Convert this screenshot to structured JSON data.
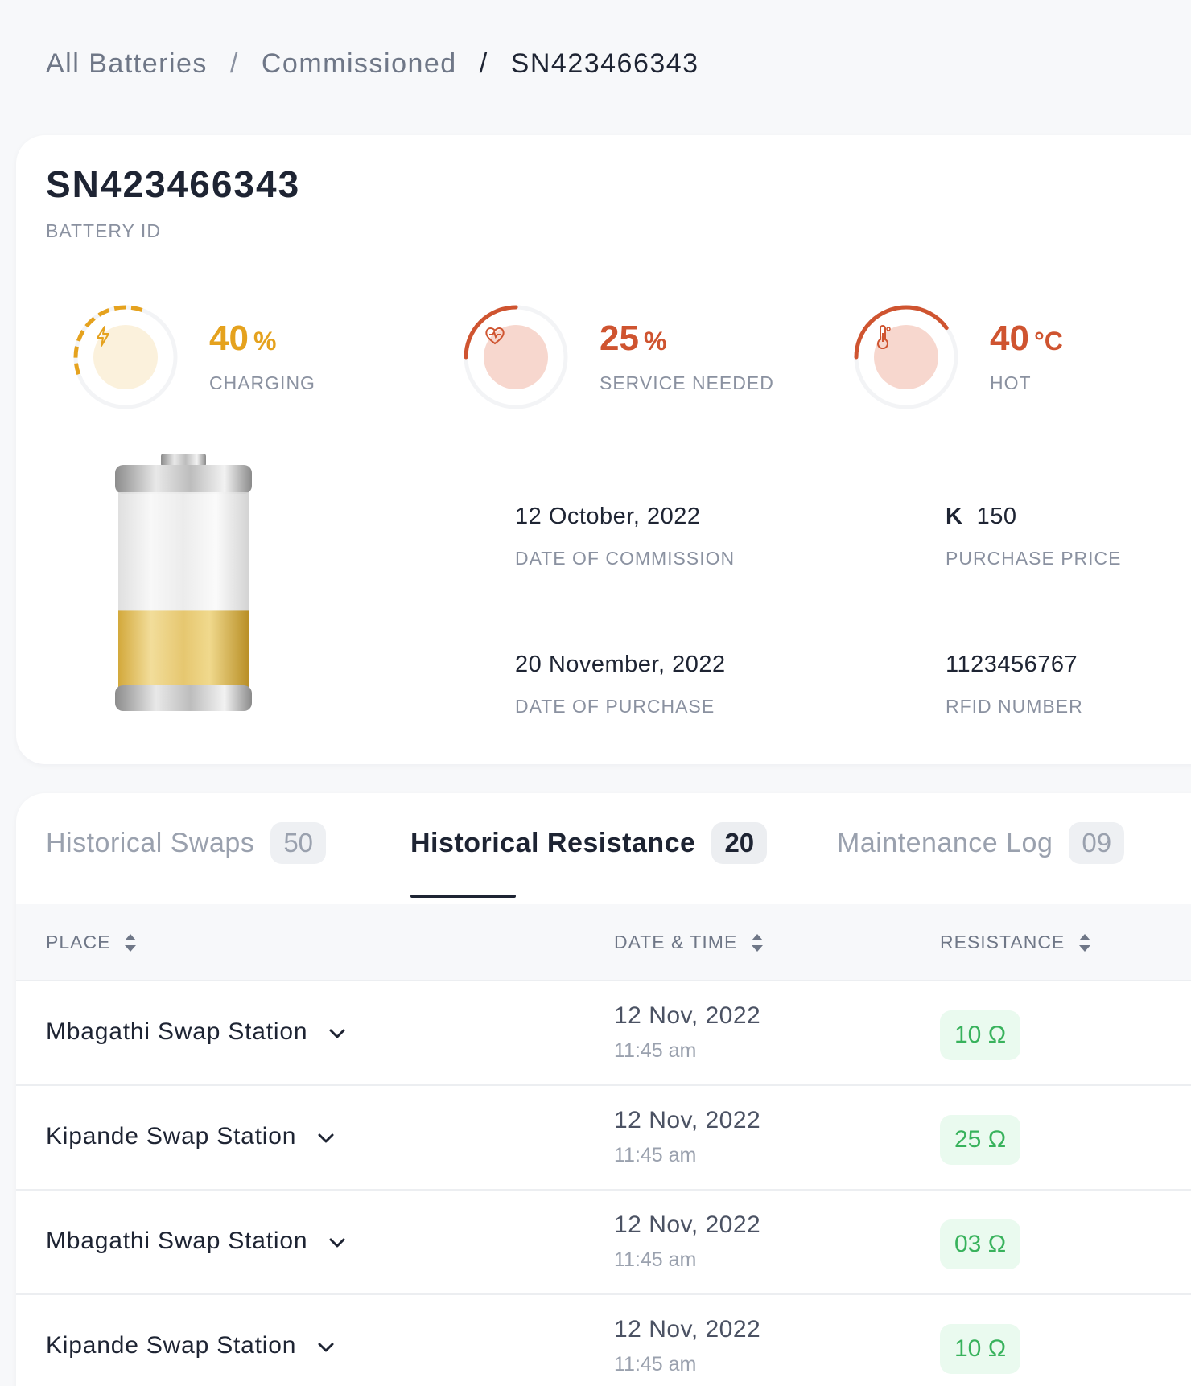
{
  "breadcrumb": {
    "items": [
      "All Batteries",
      "Commissioned",
      "SN423466343"
    ],
    "separator": "/"
  },
  "battery": {
    "id": "SN423466343",
    "id_label": "BATTERY ID",
    "stats": [
      {
        "value": "40",
        "unit": "%",
        "label": "CHARGING",
        "icon": "lightning-icon",
        "color": "#e5a21e",
        "level": 0.4
      },
      {
        "value": "25",
        "unit": "%",
        "label": "SERVICE NEEDED",
        "icon": "heart-pulse-icon",
        "color": "#cf5430",
        "level": 0.25
      },
      {
        "value": "40",
        "unit": "°C",
        "label": "HOT",
        "icon": "thermometer-icon",
        "color": "#cf5430",
        "level": 0.4
      }
    ],
    "charge_level": 0.4,
    "meta": {
      "commission_date": {
        "value": "12 October, 2022",
        "label": "DATE OF COMMISSION"
      },
      "purchase_price": {
        "currency": "K",
        "value": "150",
        "label": "PURCHASE PRICE"
      },
      "purchase_date": {
        "value": "20 November, 2022",
        "label": "DATE OF PURCHASE"
      },
      "rfid": {
        "value": "1123456767",
        "label": "RFID NUMBER"
      }
    }
  },
  "tabs": [
    {
      "label": "Historical Swaps",
      "count": "50",
      "active": false
    },
    {
      "label": "Historical Resistance",
      "count": "20",
      "active": true
    },
    {
      "label": "Maintenance Log",
      "count": "09",
      "active": false
    }
  ],
  "table": {
    "columns": [
      "PLACE",
      "DATE & TIME",
      "RESISTANCE"
    ],
    "rows": [
      {
        "place": "Mbagathi Swap Station",
        "date": "12 Nov, 2022",
        "time": "11:45 am",
        "resistance": "10 Ω"
      },
      {
        "place": "Kipande Swap Station",
        "date": "12 Nov, 2022",
        "time": "11:45 am",
        "resistance": "25 Ω"
      },
      {
        "place": "Mbagathi Swap Station",
        "date": "12 Nov, 2022",
        "time": "11:45 am",
        "resistance": "03 Ω"
      },
      {
        "place": "Kipande Swap Station",
        "date": "12 Nov, 2022",
        "time": "11:45 am",
        "resistance": "10 Ω"
      }
    ]
  },
  "colors": {
    "charging": "#e5a21e",
    "warning": "#cf5430",
    "resistance_text": "#38b25c",
    "resistance_bg": "#eafaef"
  }
}
